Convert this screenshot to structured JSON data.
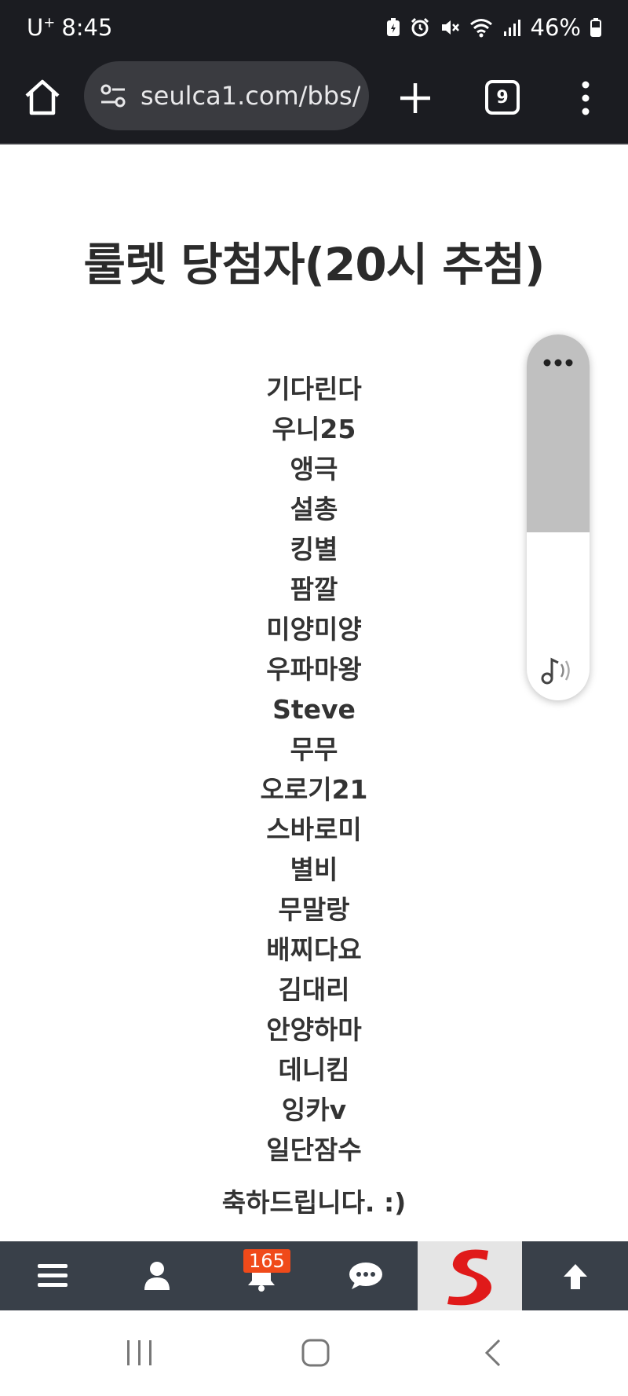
{
  "status_bar": {
    "carrier": "U",
    "carrier_sup": "+",
    "time": "8:45",
    "battery_percent": "46%",
    "icons": [
      "battery-saver-icon",
      "alarm-icon",
      "mute-icon",
      "wifi-icon",
      "signal-icon",
      "battery-icon"
    ]
  },
  "browser": {
    "url": "seulca1.com/bbs/",
    "tab_count": "9",
    "icons": [
      "home-icon",
      "tune-icon",
      "plus-icon",
      "tabs-icon",
      "more-vertical-icon"
    ]
  },
  "page": {
    "title": "룰렛 당첨자(20시 추첨)",
    "winners": [
      "기다린다",
      "우니25",
      "앵극",
      "설총",
      "킹별",
      "팜깔",
      "미양미양",
      "우파마왕",
      "Steve",
      "무무",
      "오로기21",
      "스바로미",
      "별비",
      "무말랑",
      "배찌다요",
      "김대리",
      "안양하마",
      "데니킴",
      "잉카v",
      "일단잠수"
    ],
    "congrats": "축하드립니다. :)"
  },
  "volume_widget": {
    "level": 0.54,
    "icons": [
      "more-horizontal-icon",
      "sound-icon"
    ]
  },
  "bottom_nav": {
    "notification_count": "165",
    "icons": [
      "hamburger-menu-icon",
      "user-icon",
      "bell-icon",
      "chat-bubble-icon",
      "site-logo",
      "arrow-up-icon"
    ],
    "colors": {
      "bar": "#394049",
      "badge": "#f04a1a",
      "logo": "#e01a1a"
    }
  },
  "android_nav": {
    "icons": [
      "recent-apps-icon",
      "home-button-icon",
      "back-icon"
    ]
  }
}
